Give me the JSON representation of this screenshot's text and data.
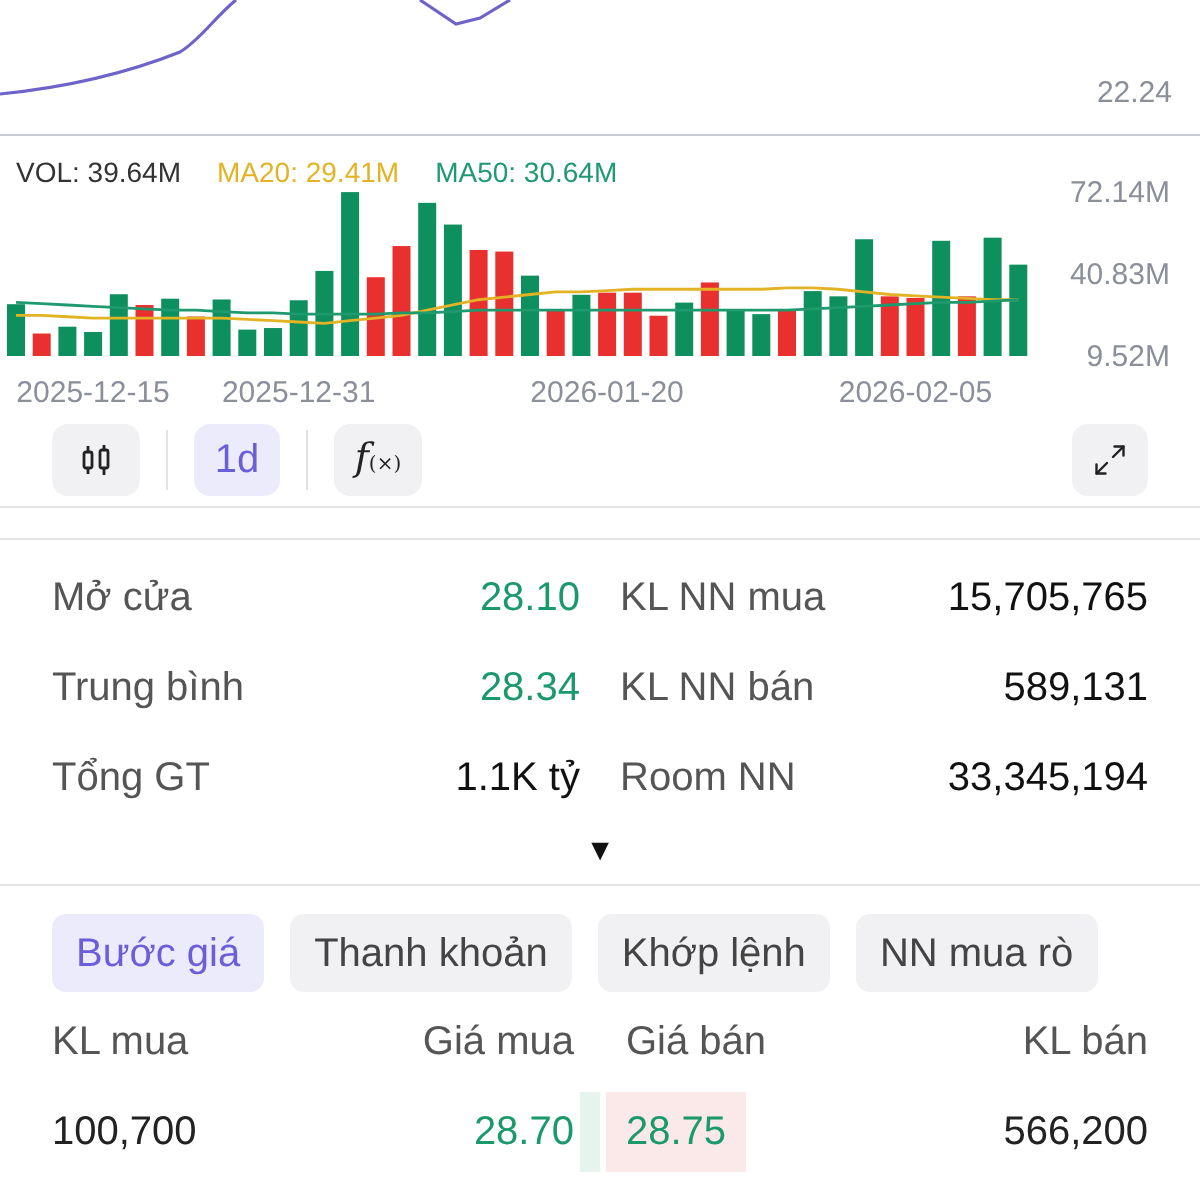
{
  "price_chart": {
    "axis_label": "22.24"
  },
  "volume_chart": {
    "legend": [
      {
        "text": "VOL: 39.64M",
        "color": "#333333"
      },
      {
        "text": "MA20: 29.41M",
        "color": "#e2b324"
      },
      {
        "text": "MA50: 30.64M",
        "color": "#1f9a6e"
      }
    ],
    "chart_data": {
      "type": "bar",
      "ylim": [
        9.52,
        72.14
      ],
      "yticks": [
        {
          "value": 72.14,
          "label": "72.14M"
        },
        {
          "value": 40.83,
          "label": "40.83M"
        },
        {
          "value": 9.52,
          "label": "9.52M"
        }
      ],
      "categories": [
        null,
        null,
        null,
        "2025-12-15",
        null,
        null,
        null,
        null,
        null,
        null,
        null,
        "2025-12-31",
        null,
        null,
        null,
        null,
        null,
        null,
        null,
        null,
        null,
        null,
        null,
        "2026-01-20",
        null,
        null,
        null,
        null,
        null,
        null,
        null,
        null,
        null,
        null,
        null,
        "2026-02-05",
        null,
        null,
        null,
        null
      ],
      "series": [
        {
          "color": "#0e8f5e",
          "values": [
            29.3,
            null,
            20.7,
            18.7,
            33.1,
            null,
            31.4,
            null,
            31.1,
            19.6,
            20.2,
            30.8,
            42.0,
            72.1,
            null,
            null,
            68.0,
            59.7,
            null,
            null,
            40.2,
            null,
            32.9,
            null,
            null,
            null,
            29.9,
            null,
            26.9,
            25.5,
            null,
            34.3,
            32.3,
            54.1,
            null,
            null,
            53.5,
            null,
            54.7,
            44.4
          ]
        },
        {
          "color": "#e8312f",
          "values": [
            null,
            18.1,
            null,
            null,
            null,
            29.0,
            null,
            24.6,
            null,
            null,
            null,
            null,
            null,
            null,
            39.6,
            51.5,
            null,
            null,
            50.0,
            49.4,
            null,
            27.2,
            null,
            33.7,
            33.7,
            24.9,
            null,
            37.6,
            null,
            null,
            26.9,
            null,
            null,
            null,
            32.3,
            31.7,
            null,
            32.3,
            null,
            null
          ]
        },
        {
          "type": "line",
          "color": "#e2b324",
          "values": [
            25,
            25,
            24.5,
            24,
            24,
            24,
            24,
            24,
            24,
            23.5,
            23,
            22.5,
            22,
            23,
            24,
            25,
            27,
            29,
            31,
            32,
            33,
            34,
            34,
            34.5,
            35,
            35,
            35,
            35,
            35,
            35,
            35.5,
            35.5,
            35,
            34,
            33,
            32.5,
            32,
            31.5,
            31,
            31
          ]
        },
        {
          "type": "line",
          "color": "#1f9a6e",
          "values": [
            30,
            29.5,
            29,
            28.5,
            28,
            27.5,
            27,
            27,
            26.5,
            26,
            26,
            25.5,
            25.5,
            25.5,
            25.5,
            26,
            26,
            26.5,
            27,
            27,
            27,
            27,
            27,
            27,
            27,
            27,
            27,
            27,
            27,
            27,
            27,
            27.5,
            28,
            28.5,
            29,
            29.5,
            30,
            30,
            30.5,
            31
          ]
        }
      ]
    }
  },
  "toolbar": {
    "intervals": [
      {
        "label": "1d",
        "selected": true
      }
    ],
    "indicator_button": {
      "label": "f",
      "sub": "(×)"
    }
  },
  "stats": [
    {
      "label": "Mở cửa",
      "value": "28.10",
      "color": "#1a9a6a",
      "label2": "KL NN mua",
      "value2": "15,705,765"
    },
    {
      "label": "Trung bình",
      "value": "28.34",
      "color": "#1a9a6a",
      "label2": "KL NN bán",
      "value2": "589,131"
    },
    {
      "label": "Tổng GT",
      "value": "1.1K tỷ",
      "color": "#111111",
      "label2": "Room NN",
      "value2": "33,345,194"
    }
  ],
  "expand_toggle": "▼",
  "tabs": [
    {
      "label": "Bước giá",
      "selected": true
    },
    {
      "label": "Thanh khoản",
      "selected": false
    },
    {
      "label": "Khớp lệnh",
      "selected": false
    },
    {
      "label": "NN mua rò",
      "selected": false
    }
  ],
  "order_book": {
    "columns": [
      "KL mua",
      "Giá mua",
      "Giá bán",
      "KL bán"
    ],
    "rows": [
      {
        "bid_volume": "100,700",
        "bid_price": "28.70",
        "ask_price": "28.75",
        "ask_volume": "566,200"
      }
    ]
  }
}
